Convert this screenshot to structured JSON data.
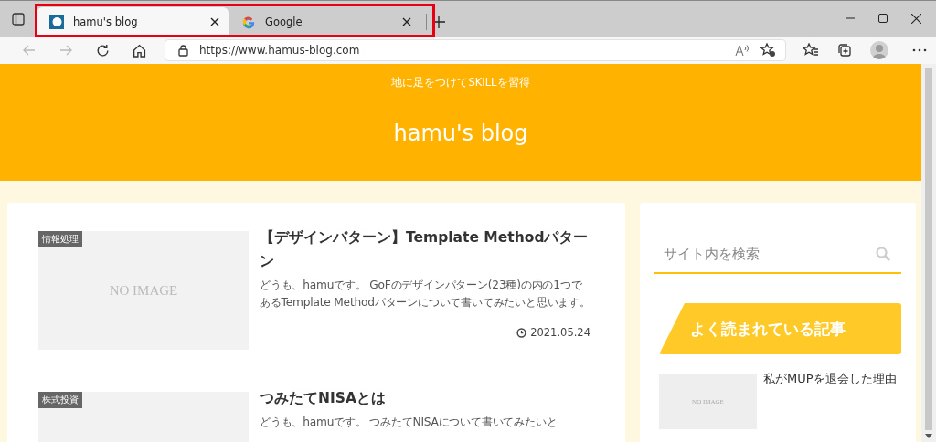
{
  "tabs": [
    {
      "title": "hamu's blog",
      "selected": true,
      "kind": "site"
    },
    {
      "title": "Google",
      "selected": false,
      "kind": "google"
    }
  ],
  "toolbar": {
    "url": "https://www.hamus-blog.com"
  },
  "header": {
    "tagline": "地に足をつけてSKILLを習得",
    "site_title": "hamu's blog"
  },
  "articles": [
    {
      "category": "情報処理",
      "thumbnail": "NO IMAGE",
      "title": "【デザインパターン】Template Methodパターン",
      "excerpt": "どうも、hamuです。 GoFのデザインパターン(23種)の内の1つであるTemplate Methodパターンについて書いてみたいと思います。",
      "date": "2021.05.24"
    },
    {
      "category": "株式投資",
      "title": "つみたてNISAとは",
      "excerpt": "どうも、hamuです。 つみたてNISAについて書いてみたいと"
    }
  ],
  "sidebar": {
    "search": {
      "placeholder": "サイト内を検索"
    },
    "popular_heading": "よく読まれている記事",
    "popular": [
      {
        "thumbnail": "NO IMAGE",
        "title": "私がMUPを退会した理由"
      }
    ]
  }
}
